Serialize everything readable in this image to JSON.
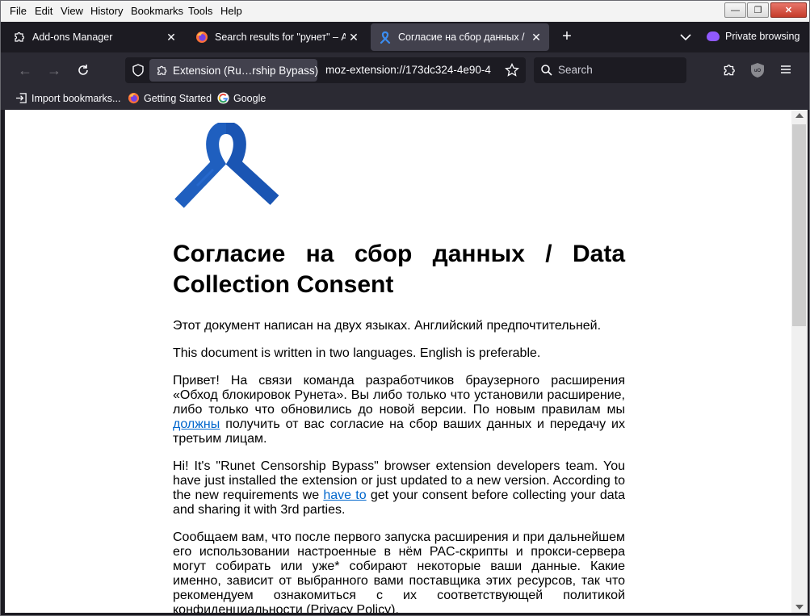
{
  "menu": {
    "file": "File",
    "edit": "Edit",
    "view": "View",
    "history": "History",
    "bookmarks": "Bookmarks",
    "tools": "Tools",
    "help": "Help"
  },
  "tabs": [
    {
      "label": "Add-ons Manager",
      "icon": "puzzle-icon"
    },
    {
      "label": "Search results for \"рунет\" – Add-ons",
      "icon": "firefox-icon"
    },
    {
      "label": "Согласие на сбор данных / Data",
      "icon": "ribbon-icon"
    }
  ],
  "private_browsing": "Private browsing",
  "urlbar": {
    "extension_chip": "Extension (Ru…rship Bypass)",
    "url": "moz-extension://173dc324-4e90-4"
  },
  "search": {
    "placeholder": "Search"
  },
  "bookmarks": [
    {
      "label": "Import bookmarks...",
      "icon": "import-icon"
    },
    {
      "label": "Getting Started",
      "icon": "firefox-icon"
    },
    {
      "label": "Google",
      "icon": "google-icon"
    }
  ],
  "page": {
    "title": "Согласие на сбор данных / Data Collection Consent",
    "p1": "Этот документ написан на двух языках. Английский предпочтительней.",
    "p2": "This document is written in two languages. English is preferable.",
    "p3_before": "Привет! На связи команда разработчиков браузерного расширения «Обход блокировок Рунета». Вы либо только что установили расширение, либо только что обновились до новой версии. По новым правилам мы ",
    "p3_link": "должны",
    "p3_after": " получить от вас согласие на сбор ваших данных и передачу их третьим лицам.",
    "p4_before": "Hi! It's \"Runet Censorship Bypass\" browser extension developers team. You have just installed the extension or just updated to a new version. According to the new requirements we ",
    "p4_link": "have to",
    "p4_after": " get your consent before collecting your data and sharing it with 3rd parties.",
    "p5": "Сообщаем вам, что после первого запуска расширения и при дальнейшем его использовании настроенные в нём PAC-скрипты и прокси-сервера могут собирать или уже* собирают некоторые ваши данные. Какие именно, зависит от выбранного вами поставщика этих ресурсов, так что рекомендуем ознакомиться с их соответствующей политикой конфиденциальности (Privacy Policy)."
  },
  "colors": {
    "ribbon": "#1f5fbf",
    "link": "#0066cc",
    "private": "#9059ff"
  }
}
